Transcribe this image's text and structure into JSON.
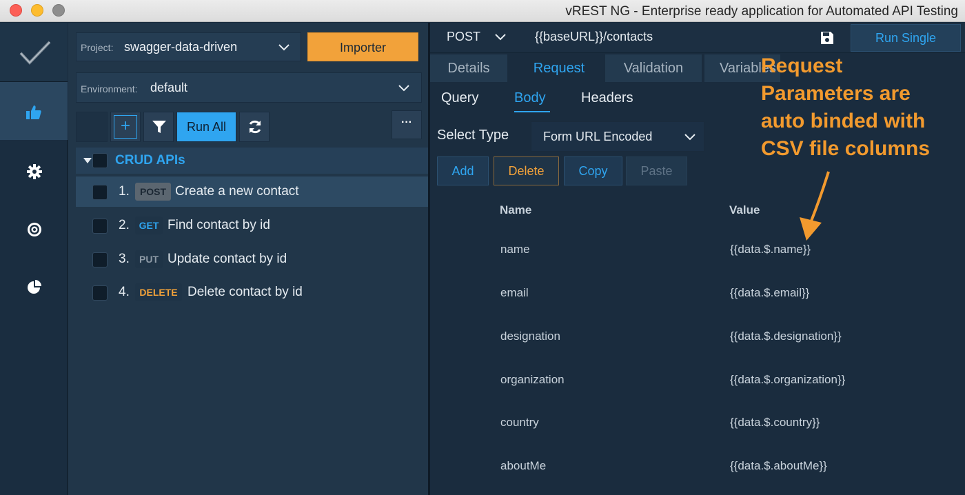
{
  "window": {
    "title": "vREST NG - Enterprise ready application for Automated API Testing"
  },
  "rail": {
    "items": [
      {
        "icon": "check-logo-icon"
      },
      {
        "icon": "thumbs-up-icon",
        "active": true
      },
      {
        "icon": "gear-icon"
      },
      {
        "icon": "target-icon"
      },
      {
        "icon": "pie-chart-icon"
      }
    ]
  },
  "sidebar": {
    "project_label": "Project:",
    "project_value": "swagger-data-driven",
    "importer_label": "Importer",
    "environment_label": "Environment:",
    "environment_value": "default",
    "toolbar": {
      "add": "+",
      "run_all": "Run All",
      "more": "···"
    },
    "group": {
      "label": "CRUD APIs"
    },
    "requests": [
      {
        "num": "1.",
        "method": "POST",
        "title": "Create a new contact",
        "selected": true
      },
      {
        "num": "2.",
        "method": "GET",
        "title": "Find contact by id"
      },
      {
        "num": "3.",
        "method": "PUT",
        "title": "Update contact by id"
      },
      {
        "num": "4.",
        "method": "DELETE",
        "title": "Delete contact by id"
      }
    ]
  },
  "main": {
    "method": "POST",
    "url": "{{baseURL}}/contacts",
    "run_single": "Run Single",
    "tabs": [
      "Details",
      "Request",
      "Validation",
      "Variables"
    ],
    "active_tab": "Request",
    "subtabs": [
      "Query",
      "Body",
      "Headers"
    ],
    "active_subtab": "Body",
    "select_type_label": "Select Type",
    "select_type_value": "Form URL Encoded",
    "actions": [
      "Add",
      "Delete",
      "Copy",
      "Paste"
    ],
    "table": {
      "headers": [
        "Name",
        "Value"
      ],
      "rows": [
        {
          "name": "name",
          "value": "{{data.$.name}}"
        },
        {
          "name": "email",
          "value": "{{data.$.email}}"
        },
        {
          "name": "designation",
          "value": "{{data.$.designation}}"
        },
        {
          "name": "organization",
          "value": "{{data.$.organization}}"
        },
        {
          "name": "country",
          "value": "{{data.$.country}}"
        },
        {
          "name": "aboutMe",
          "value": "{{data.$.aboutMe}}"
        }
      ]
    }
  },
  "annotation": {
    "lines": [
      "Request",
      "Parameters are",
      "auto binded with",
      "CSV file columns"
    ],
    "color": "#f29a2e"
  },
  "colors": {
    "accent": "#2fa5f0",
    "importer": "#f2a23a",
    "post_badge": "#5b6670",
    "get_badge": "#2fa5f0",
    "put_badge": "#8d9aa6",
    "delete_badge": "#f2a23a"
  }
}
